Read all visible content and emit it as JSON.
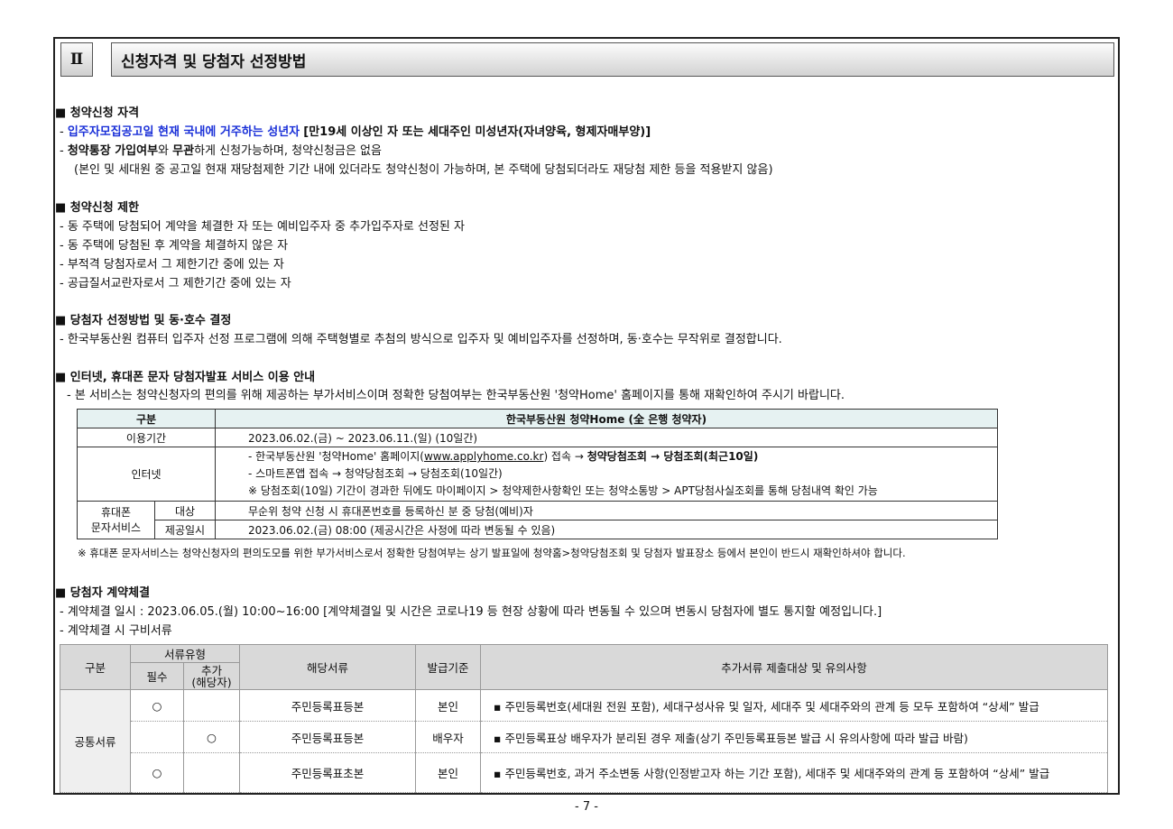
{
  "header": {
    "roman": "Ⅱ",
    "title": "신청자격 및 당첨자 선정방법"
  },
  "s1": {
    "heading": "■ 청약신청 자격",
    "l1_blue": "입주자모집공고일 현재 국내에 거주하는 성년자",
    "l1_bold": "[만19세 이상인 자 또는 세대주인 미성년자(자녀양육, 형제자매부양)]",
    "l2_a": "청약통장 가입여부",
    "l2_b": "와 ",
    "l2_c": "무관",
    "l2_d": "하게 신청가능하며, 청약신청금은 없음",
    "l3": "(본인 및 세대원 중 공고일 현재 재당첨제한 기간 내에 있더라도 청약신청이 가능하며, 본 주택에 당첨되더라도 재당첨 제한 등을 적용받지 않음)"
  },
  "s2": {
    "heading": "■ 청약신청 제한",
    "items": [
      "- 동 주택에 당첨되어 계약을 체결한 자 또는 예비입주자 중 추가입주자로 선정된 자",
      "- 동 주택에 당첨된 후 계약을 체결하지 않은 자",
      "- 부적격 당첨자로서 그 제한기간 중에 있는 자",
      "- 공급질서교란자로서 그 제한기간 중에 있는 자"
    ]
  },
  "s3": {
    "heading": "■ 당첨자 선정방법 및 동·호수 결정",
    "l1": "- 한국부동산원 컴퓨터 입주자 선정 프로그램에 의해 주택형별로 추첨의 방식으로 입주자 및 예비입주자를 선정하며, 동·호수는 무작위로 결정합니다."
  },
  "s4": {
    "heading": "■ 인터넷, 휴대폰 문자 당첨자발표 서비스 이용 안내",
    "l1": "- 본 서비스는 청약신청자의 편의를 위해 제공하는 부가서비스이며 정확한 당첨여부는 한국부동산원 '청약Home' 홈페이지를 통해 재확인하여 주시기 바랍니다.",
    "table": {
      "h1": "구분",
      "h2": "한국부동산원 청약Home (全 은행 청약자)",
      "period_label": "이용기간",
      "period_value": "2023.06.02.(금) ~ 2023.06.11.(일) (10일간)",
      "internet_label": "인터넷",
      "internet_l1_a": "- 한국부동산원 '청약Home' 홈페이지(",
      "internet_l1_link": "www.applyhome.co.kr",
      "internet_l1_b": ") 접속 → ",
      "internet_l1_bold": "청약당첨조회 → 당첨조회(최근10일)",
      "internet_l2": "- 스마트폰앱 접속  → 청약당첨조회 → 당첨조회(10일간)",
      "internet_l3": "※ 당첨조회(10일) 기간이 경과한 뒤에도 마이페이지 > 청약제한사항확인 또는 청약소통방 > APT당첨사실조회를 통해 당첨내역 확인 가능",
      "sms_label1": "휴대폰",
      "sms_label2": "문자서비스",
      "target_label": "대상",
      "target_value": "무순위 청약 신청 시 휴대폰번호를 등록하신 분 중 당첨(예비)자",
      "time_label": "제공일시",
      "time_value": "2023.06.02.(금) 08:00 (제공시간은 사정에 따라 변동될 수 있음)"
    },
    "note": "※ 휴대폰 문자서비스는 청약신청자의 편의도모를 위한 부가서비스로서 정확한 당첨여부는 상기 발표일에 청약홈>청약당첨조회 및 당첨자 발표장소 등에서 본인이 반드시 재확인하셔야 합니다."
  },
  "s5": {
    "heading": "■ 당첨자 계약체결",
    "l1": "- 계약체결 일시 : 2023.06.05.(월) 10:00~16:00 [계약체결일 및 시간은 코로나19 등 현장 상황에 따라 변동될 수 있으며 변동시 당첨자에 별도 통지할 예정입니다.]",
    "l2": "- 계약체결 시 구비서류",
    "table": {
      "h_gubun": "구분",
      "h_type": "서류유형",
      "h_required": "필수",
      "h_extra1": "추가",
      "h_extra2": "(해당자)",
      "h_doc": "해당서류",
      "h_issuer": "발급기준",
      "h_notes": "추가서류 제출대상 및 유의사항",
      "group": "공통서류",
      "rows": [
        {
          "req": "○",
          "extra": "",
          "doc": "주민등록표등본",
          "issuer": "본인",
          "note": "▪ 주민등록번호(세대원 전원 포함), 세대구성사유 및 일자, 세대주 및 세대주와의 관계 등 모두 포함하여 “상세” 발급"
        },
        {
          "req": "",
          "extra": "○",
          "doc": "주민등록표등본",
          "issuer": "배우자",
          "note": "▪ 주민등록표상 배우자가 분리된 경우 제출(상기 주민등록표등본 발급 시 유의사항에 따라 발급 바람)"
        },
        {
          "req": "○",
          "extra": "",
          "doc": "주민등록표초본",
          "issuer": "본인",
          "note": "▪ 주민등록번호, 과거 주소변동 사항(인정받고자 하는 기간 포함), 세대주 및 세대주와의 관계 등 포함하여 “상세” 발급"
        }
      ]
    }
  },
  "footer": {
    "page": "- 7 -"
  }
}
